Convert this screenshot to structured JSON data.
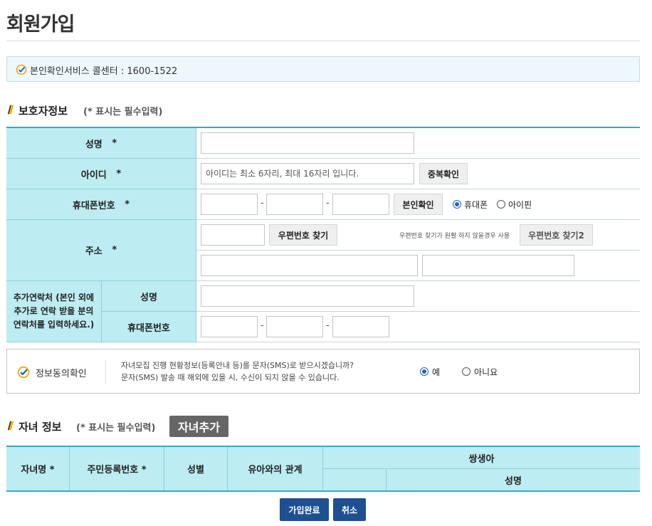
{
  "page": {
    "title": "회원가입"
  },
  "notice": {
    "text": "본인확인서비스 콜센터 : 1600-1522"
  },
  "guardian": {
    "section_title": "보호자정보",
    "required_note": "(* 표시는 필수입력)",
    "name_label": "성명",
    "id_label": "아이디",
    "id_placeholder": "아이디는 최소 6자리, 최대 16자리 입니다.",
    "dup_check": "중복확인",
    "phone_label": "휴대폰번호",
    "verify_button": "본인확인",
    "verify_options": [
      "휴대폰",
      "아이핀"
    ],
    "verify_selected": "휴대폰",
    "address_label": "주소",
    "zip_search": "우편번호 찾기",
    "zip_hint": "우편번호 찾기가 원활 하지 않을경우 사용",
    "zip_search2": "우편번호 찾기2",
    "extra_contact_label": "추가연락처 (본인 외에 추가로 연락 받을 분의 연락처를 입력하세요.)",
    "extra_name_label": "성명",
    "extra_phone_label": "휴대폰번호",
    "required_mark": "*",
    "dash": "-"
  },
  "consent": {
    "label": "정보동의확인",
    "line1": "자녀모집 진행 현황정보(등록안내 등)를 문자(SMS)로 받으시겠습니까?",
    "line2": "문자(SMS) 발송 때 해외에 있을 시, 수신이 되지 않을 수 있습니다.",
    "options": [
      "예",
      "아니요"
    ],
    "selected": "예"
  },
  "children": {
    "section_title": "자녀 정보",
    "required_note": "(* 표시는 필수입력)",
    "add_button": "자녀추가",
    "columns": [
      "자녀명 *",
      "주민등록번호 *",
      "성별",
      "유아와의 관계",
      "쌍생아",
      "성명"
    ]
  },
  "actions": {
    "submit": "가입완료",
    "cancel": "취소"
  },
  "colors": {
    "label_bg": "#bdecf3",
    "accent": "#3aa8c4",
    "button_dark": "#1d4f91",
    "radio": "#1e64c8"
  }
}
